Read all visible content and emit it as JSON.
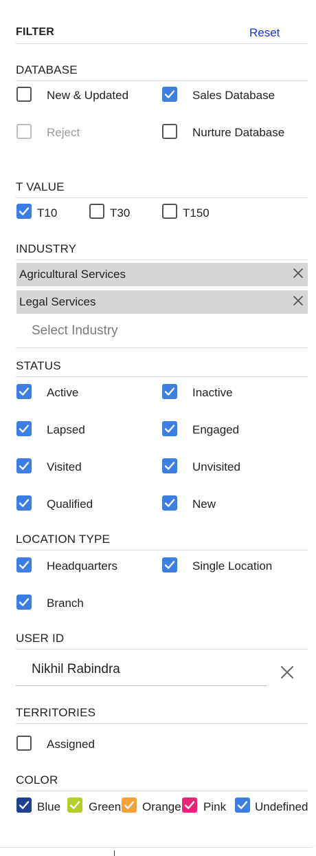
{
  "header": {
    "title": "FILTER",
    "reset_label": "Reset"
  },
  "database": {
    "title": "DATABASE",
    "options": [
      {
        "label": "New & Updated",
        "checked": false,
        "disabled": false
      },
      {
        "label": "Sales Database",
        "checked": true,
        "disabled": false
      },
      {
        "label": "Reject",
        "checked": false,
        "disabled": true
      },
      {
        "label": "Nurture Database",
        "checked": false,
        "disabled": false
      }
    ]
  },
  "t_value": {
    "title": "T VALUE",
    "options": [
      {
        "label": "T10",
        "checked": true
      },
      {
        "label": "T30",
        "checked": false
      },
      {
        "label": "T150",
        "checked": false
      }
    ]
  },
  "industry": {
    "title": "INDUSTRY",
    "selected": [
      "Agricultural Services",
      "Legal Services"
    ],
    "placeholder": "Select Industry"
  },
  "status": {
    "title": "STATUS",
    "options": [
      {
        "label": "Active",
        "checked": true
      },
      {
        "label": "Inactive",
        "checked": true
      },
      {
        "label": "Lapsed",
        "checked": true
      },
      {
        "label": "Engaged",
        "checked": true
      },
      {
        "label": "Visited",
        "checked": true
      },
      {
        "label": "Unvisited",
        "checked": true
      },
      {
        "label": "Qualified",
        "checked": true
      },
      {
        "label": "New",
        "checked": true
      }
    ]
  },
  "location_type": {
    "title": "LOCATION TYPE",
    "options": [
      {
        "label": "Headquarters",
        "checked": true
      },
      {
        "label": "Single Location",
        "checked": true
      },
      {
        "label": "Branch",
        "checked": true
      }
    ]
  },
  "user_id": {
    "title": "USER ID",
    "value": "Nikhil Rabindra"
  },
  "territories": {
    "title": "TERRITORIES",
    "options": [
      {
        "label": "Assigned",
        "checked": false
      }
    ]
  },
  "color": {
    "title": "COLOR",
    "options": [
      {
        "label": "Blue",
        "color": "#1f3f8f",
        "checked": true
      },
      {
        "label": "Green",
        "color": "#b4cf2a",
        "checked": true
      },
      {
        "label": "Orange",
        "color": "#f7a13a",
        "checked": true
      },
      {
        "label": "Pink",
        "color": "#e8247a",
        "checked": true
      },
      {
        "label": "Undefined",
        "color": "#3d7fe0",
        "checked": true
      }
    ]
  },
  "colors": {
    "accent": "#3d7fe0",
    "link": "#1a36d8"
  }
}
